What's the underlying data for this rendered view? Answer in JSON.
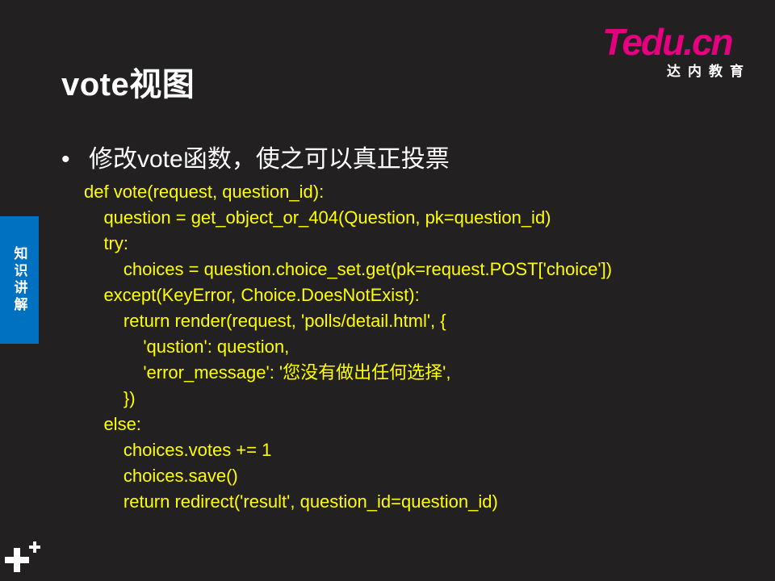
{
  "slide": {
    "title": "vote视图",
    "bullet": "修改vote函数，使之可以真正投票",
    "side_tab": "知识讲解"
  },
  "logo": {
    "word_t": "T",
    "word_rest": "edu",
    "word_cn": ".cn",
    "subtitle": "达内教育"
  },
  "code_lines": [
    "def vote(request, question_id):",
    "    question = get_object_or_404(Question, pk=question_id)",
    "    try:",
    "        choices = question.choice_set.get(pk=request.POST['choice'])",
    "    except(KeyError, Choice.DoesNotExist):",
    "        return render(request, 'polls/detail.html', {",
    "            'qustion': question,",
    "            'error_message': '您没有做出任何选择',",
    "        })",
    "    else:",
    "        choices.votes += 1",
    "        choices.save()",
    "        return redirect('result', question_id=question_id)"
  ],
  "colors": {
    "background": "#222020",
    "code": "#ffff00",
    "side_tab": "#0070c0",
    "logo": "#e4007f"
  }
}
